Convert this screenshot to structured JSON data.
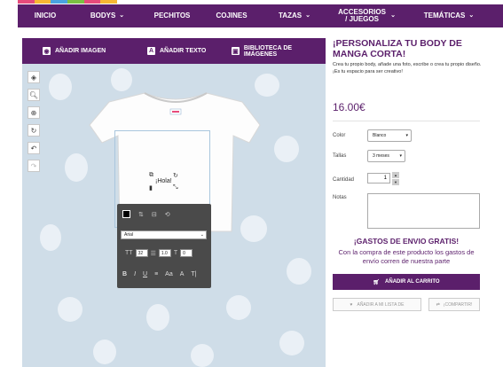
{
  "brand": {
    "colors": [
      "#e64b7b",
      "#f7b733",
      "#4aa3df",
      "#7bc043",
      "#e64b7b",
      "#f7b733"
    ]
  },
  "nav": {
    "items": [
      {
        "label": "INICIO",
        "has_dropdown": false
      },
      {
        "label": "BODYS",
        "has_dropdown": true
      },
      {
        "label": "PECHITOS",
        "has_dropdown": false
      },
      {
        "label": "COJINES",
        "has_dropdown": false
      },
      {
        "label": "TAZAS",
        "has_dropdown": true
      },
      {
        "label": "ACCESORIOS / JUEGOS",
        "has_dropdown": true
      },
      {
        "label": "TEMÁTICAS",
        "has_dropdown": true
      }
    ],
    "background": "#5b1f6b"
  },
  "editor": {
    "toolbar": {
      "add_image": "AÑADIR IMAGEN",
      "add_text": "AÑADIR TEXTO",
      "image_library": "BIBLIOTECA DE IMÁGENES"
    },
    "side_tools": [
      "layers-icon",
      "zoom-out-icon",
      "zoom-in-icon",
      "rotate-icon",
      "undo-icon",
      "redo-icon"
    ],
    "text_object": {
      "content": "¡Hola!"
    },
    "text_panel": {
      "font": "Arial",
      "font_size": "32",
      "line_height": "1.0",
      "letter_spacing": "0",
      "color": "#000000"
    }
  },
  "product": {
    "title": "¡PERSONALIZA TU BODY DE MANGA CORTA!",
    "description": "Crea tu propio body, añade una foto, escribe o crea tu propio diseño. ¡Es tu espacio para ser creativo!",
    "price": "16.00€",
    "color_label": "Color",
    "color_value": "Blanco",
    "size_label": "Tallas",
    "size_value": "3 meses",
    "qty_label": "Cantidad",
    "qty_value": "1",
    "notes_label": "Notas",
    "shipping_title": "¡GASTOS DE ENVIO GRATIS!",
    "shipping_text": "Con la compra de este producto los gastos de envío corren de nuestra parte",
    "add_to_cart": "AÑADIR AL CARRITO",
    "wishlist": "AÑADIR A MI LISTA DE",
    "share": "¡COMPARTIR!"
  }
}
